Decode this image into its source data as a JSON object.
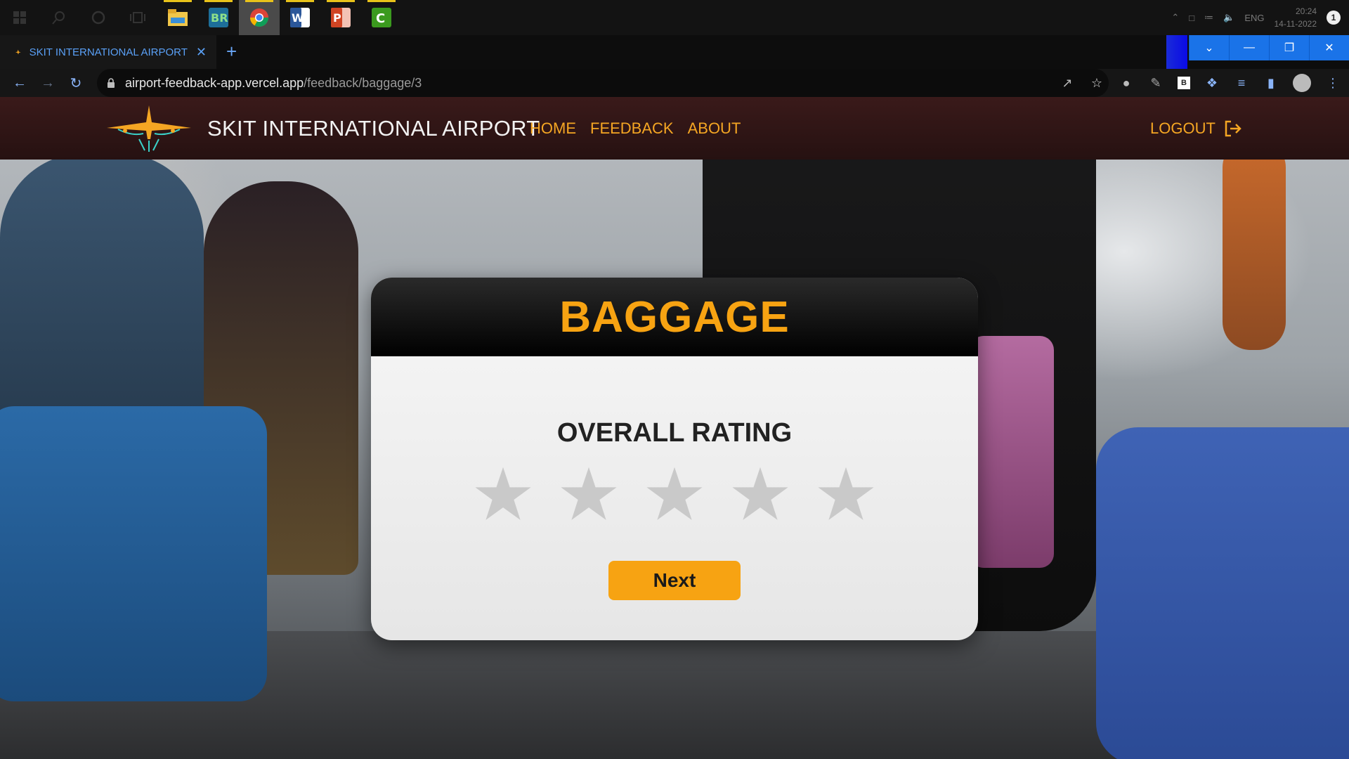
{
  "taskbar": {
    "apps": [
      {
        "name": "file-explorer",
        "color": "#f0c64a"
      },
      {
        "name": "bluej",
        "color": "#2a8a4a"
      },
      {
        "name": "chrome",
        "color": "#4285f4"
      },
      {
        "name": "word",
        "color": "#2b579a"
      },
      {
        "name": "powerpoint",
        "color": "#d04423"
      },
      {
        "name": "camtasia",
        "color": "#3b9a1e"
      }
    ],
    "tray": {
      "lang": "ENG",
      "time": "20:24",
      "date": "14-11-2022",
      "notifications": "1"
    }
  },
  "browser": {
    "tab_title": "SKIT INTERNATIONAL AIRPORT",
    "url_host": "airport-feedback-app.vercel.app",
    "url_path": "/feedback/baggage/3"
  },
  "site": {
    "brand": "SKIT INTERNATIONAL AIRPORT",
    "nav": {
      "home": "HOME",
      "feedback": "FEEDBACK",
      "about": "ABOUT"
    },
    "logout": "LOGOUT"
  },
  "card": {
    "title": "BAGGAGE",
    "rating_label": "OVERALL RATING",
    "rating": 0,
    "max_rating": 5,
    "next_label": "Next"
  },
  "colors": {
    "accent": "#f7a312",
    "header_bg": "#2e1414",
    "star_empty": "#c9c9c9"
  }
}
